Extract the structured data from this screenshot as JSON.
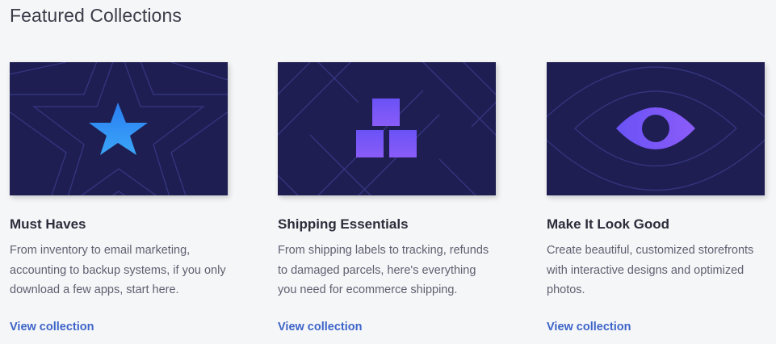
{
  "section": {
    "title": "Featured Collections"
  },
  "cards": [
    {
      "title": "Must Haves",
      "description": "From inventory to email marketing, accounting to backup systems, if you only download a few apps, start here.",
      "link": "View collection",
      "icon": "star-icon"
    },
    {
      "title": "Shipping Essentials",
      "description": "From shipping labels to tracking, refunds to damaged parcels, here's everything you need for ecommerce shipping.",
      "link": "View collection",
      "icon": "boxes-icon"
    },
    {
      "title": "Make It Look Good",
      "description": "Create beautiful, customized storefronts with interactive designs and optimized photos.",
      "link": "View collection",
      "icon": "eye-icon"
    }
  ],
  "colors": {
    "card_background": "#1e1e52",
    "pattern_line": "#3a3a8a",
    "accent_blue": "#3a8ef6",
    "accent_purple": "#7b5cff",
    "link": "#3c64c8",
    "page_background": "#f5f6f8"
  }
}
